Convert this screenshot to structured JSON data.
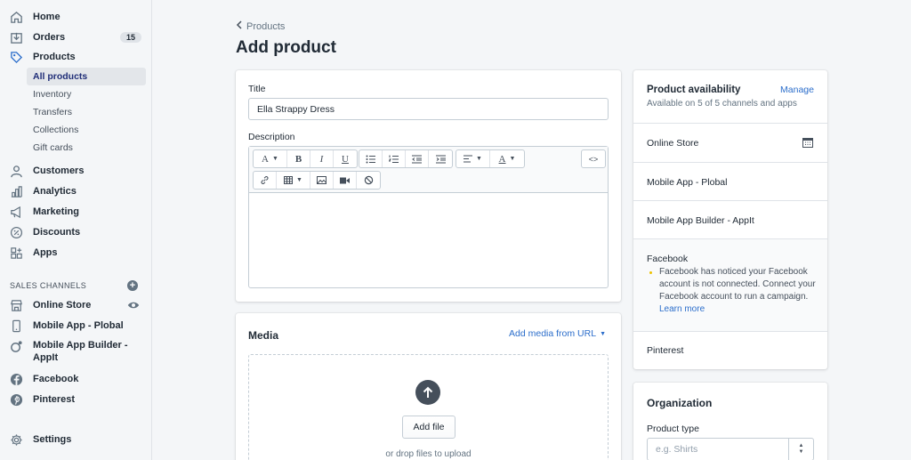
{
  "sidebar": {
    "home": "Home",
    "orders": "Orders",
    "orders_badge": "15",
    "products": "Products",
    "sub": [
      "All products",
      "Inventory",
      "Transfers",
      "Collections",
      "Gift cards"
    ],
    "customers": "Customers",
    "analytics": "Analytics",
    "marketing": "Marketing",
    "discounts": "Discounts",
    "apps": "Apps",
    "sales_channels_label": "SALES CHANNELS",
    "channels": [
      "Online Store",
      "Mobile App - Plobal",
      "Mobile App Builder -",
      "AppIt",
      "Facebook",
      "Pinterest"
    ],
    "settings": "Settings"
  },
  "header": {
    "breadcrumb": "Products",
    "title": "Add product"
  },
  "form": {
    "title_label": "Title",
    "title_value": "Ella Strappy Dress",
    "description_label": "Description",
    "toolbar": {
      "font": "A",
      "bold": "B",
      "italic": "I",
      "underline": "U",
      "color": "A",
      "source": "<>"
    }
  },
  "media": {
    "title": "Media",
    "add_url": "Add media from URL",
    "add_file": "Add file",
    "drop_hint": "or drop files to upload"
  },
  "availability": {
    "title": "Product availability",
    "manage": "Manage",
    "subtitle": "Available on 5 of 5 channels and apps",
    "rows": [
      "Online Store",
      "Mobile App - Plobal",
      "Mobile App Builder - AppIt",
      "Facebook",
      "Pinterest"
    ],
    "facebook_note": "Facebook has noticed your Facebook account is not connected. Connect your Facebook account to run a campaign.",
    "learn_more": "Learn more"
  },
  "organization": {
    "title": "Organization",
    "product_type_label": "Product type",
    "product_type_placeholder": "e.g. Shirts"
  },
  "colors": {
    "accent": "#2c6ecb",
    "active_nav": "#202e78",
    "warning_dot": "#eec200"
  }
}
